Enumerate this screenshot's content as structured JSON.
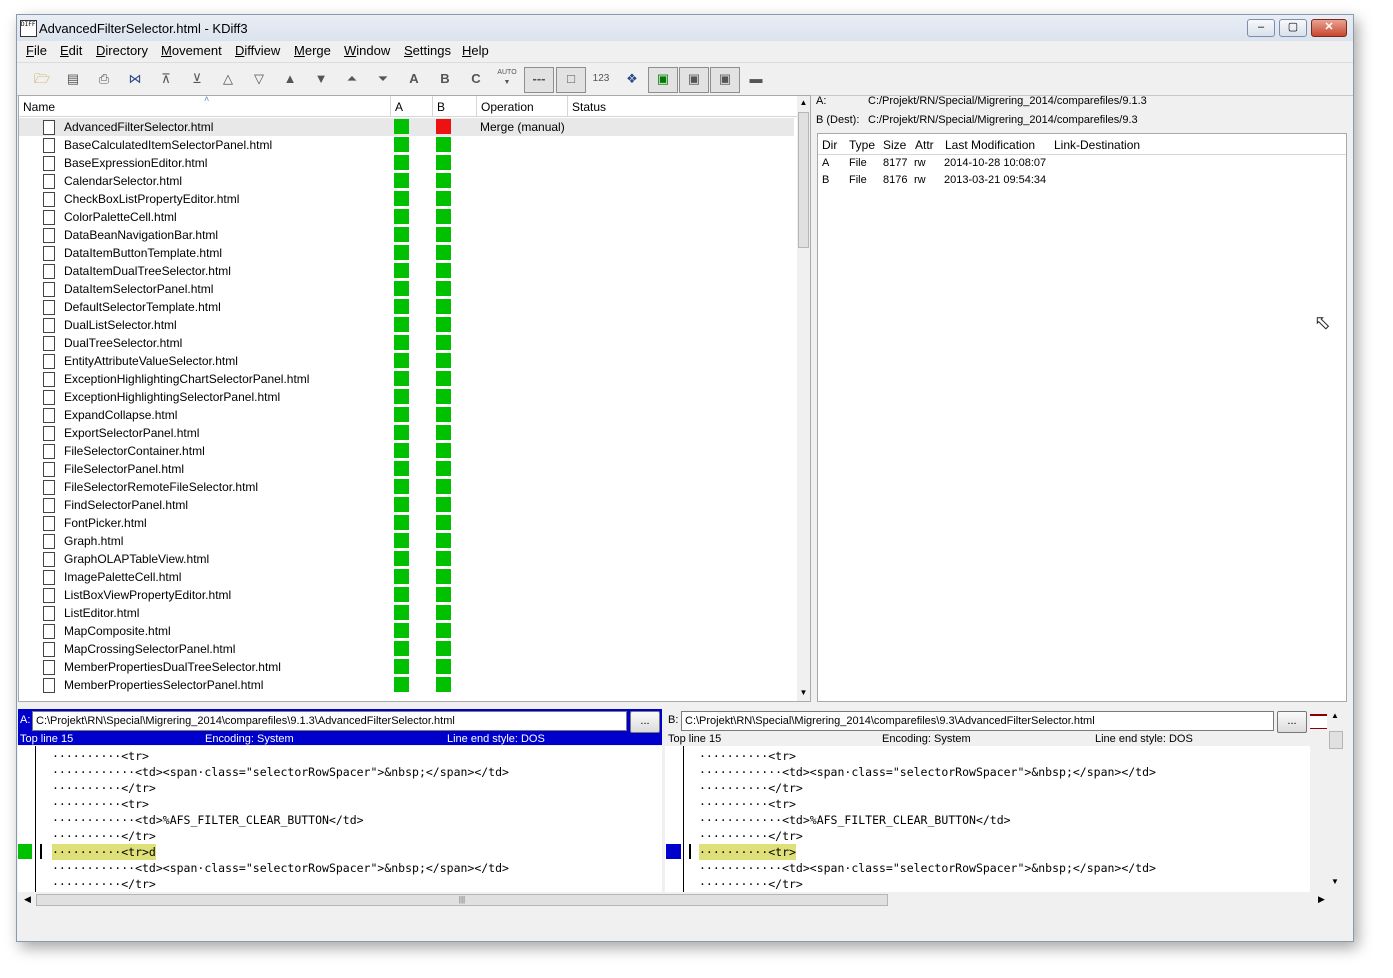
{
  "window": {
    "title": "AdvancedFilterSelector.html - KDiff3",
    "app_icon_text": "DIFF3"
  },
  "menu": [
    "File",
    "Edit",
    "Directory",
    "Movement",
    "Diffview",
    "Merge",
    "Window",
    "Settings",
    "Help"
  ],
  "toolbar": {
    "auto_label": "AUTO",
    "a_label": "A",
    "b_label": "B",
    "c_label": "C",
    "numbers_label": "123"
  },
  "dir_table": {
    "headers": {
      "name": "Name",
      "a": "A",
      "b": "B",
      "operation": "Operation",
      "status": "Status"
    },
    "rows": [
      {
        "name": "AdvancedFilterSelector.html",
        "operation": "Merge (manual)",
        "b_status": "red"
      },
      {
        "name": "BaseCalculatedItemSelectorPanel.html",
        "operation": "",
        "b_status": "green"
      },
      {
        "name": "BaseExpressionEditor.html",
        "operation": "",
        "b_status": "green"
      },
      {
        "name": "CalendarSelector.html",
        "operation": "",
        "b_status": "green"
      },
      {
        "name": "CheckBoxListPropertyEditor.html",
        "operation": "",
        "b_status": "green"
      },
      {
        "name": "ColorPaletteCell.html",
        "operation": "",
        "b_status": "green"
      },
      {
        "name": "DataBeanNavigationBar.html",
        "operation": "",
        "b_status": "green"
      },
      {
        "name": "DataItemButtonTemplate.html",
        "operation": "",
        "b_status": "green"
      },
      {
        "name": "DataItemDualTreeSelector.html",
        "operation": "",
        "b_status": "green"
      },
      {
        "name": "DataItemSelectorPanel.html",
        "operation": "",
        "b_status": "green"
      },
      {
        "name": "DefaultSelectorTemplate.html",
        "operation": "",
        "b_status": "green"
      },
      {
        "name": "DualListSelector.html",
        "operation": "",
        "b_status": "green"
      },
      {
        "name": "DualTreeSelector.html",
        "operation": "",
        "b_status": "green"
      },
      {
        "name": "EntityAttributeValueSelector.html",
        "operation": "",
        "b_status": "green"
      },
      {
        "name": "ExceptionHighlightingChartSelectorPanel.html",
        "operation": "",
        "b_status": "green"
      },
      {
        "name": "ExceptionHighlightingSelectorPanel.html",
        "operation": "",
        "b_status": "green"
      },
      {
        "name": "ExpandCollapse.html",
        "operation": "",
        "b_status": "green"
      },
      {
        "name": "ExportSelectorPanel.html",
        "operation": "",
        "b_status": "green"
      },
      {
        "name": "FileSelectorContainer.html",
        "operation": "",
        "b_status": "green"
      },
      {
        "name": "FileSelectorPanel.html",
        "operation": "",
        "b_status": "green"
      },
      {
        "name": "FileSelectorRemoteFileSelector.html",
        "operation": "",
        "b_status": "green"
      },
      {
        "name": "FindSelectorPanel.html",
        "operation": "",
        "b_status": "green"
      },
      {
        "name": "FontPicker.html",
        "operation": "",
        "b_status": "green"
      },
      {
        "name": "Graph.html",
        "operation": "",
        "b_status": "green"
      },
      {
        "name": "GraphOLAPTableView.html",
        "operation": "",
        "b_status": "green"
      },
      {
        "name": "ImagePaletteCell.html",
        "operation": "",
        "b_status": "green"
      },
      {
        "name": "ListBoxViewPropertyEditor.html",
        "operation": "",
        "b_status": "green"
      },
      {
        "name": "ListEditor.html",
        "operation": "",
        "b_status": "green"
      },
      {
        "name": "MapComposite.html",
        "operation": "",
        "b_status": "green"
      },
      {
        "name": "MapCrossingSelectorPanel.html",
        "operation": "",
        "b_status": "green"
      },
      {
        "name": "MemberPropertiesDualTreeSelector.html",
        "operation": "",
        "b_status": "green"
      },
      {
        "name": "MemberPropertiesSelectorPanel.html",
        "operation": "",
        "b_status": "green"
      }
    ]
  },
  "info_panel": {
    "a_label": "A:",
    "a_path": "C:/Projekt/RN/Special/Migrering_2014/comparefiles/9.1.3",
    "b_label": "B (Dest):",
    "b_path": "C:/Projekt/RN/Special/Migrering_2014/comparefiles/9.3",
    "headers": [
      "Dir",
      "Type",
      "Size",
      "Attr",
      "Last Modification",
      "Link-Destination"
    ],
    "rows": [
      [
        "A",
        "File",
        "8177",
        "rw",
        "2014-10-28 10:08:07",
        ""
      ],
      [
        "B",
        "File",
        "8176",
        "rw",
        "2013-03-21 09:54:34",
        ""
      ]
    ]
  },
  "diff_a": {
    "label": "A:",
    "path": "C:\\Projekt\\RN\\Special\\Migrering_2014\\comparefiles\\9.1.3\\AdvancedFilterSelector.html",
    "browse": "...",
    "top_line": "Top line 15",
    "encoding": "Encoding: System",
    "line_end": "Line end style: DOS",
    "lines": [
      "··········<tr>",
      "············<td><span·class=\"selectorRowSpacer\">&nbsp;</span></td>",
      "··········</tr>",
      "··········<tr>",
      "············<td>%AFS_FILTER_CLEAR_BUTTON</td>",
      "··········</tr>",
      "··········<tr>d",
      "············<td><span·class=\"selectorRowSpacer\">&nbsp;</span></td>",
      "··········</tr>"
    ]
  },
  "diff_b": {
    "label": "B:",
    "path": "C:\\Projekt\\RN\\Special\\Migrering_2014\\comparefiles\\9.3\\AdvancedFilterSelector.html",
    "browse": "...",
    "top_line": "Top line 15",
    "encoding": "Encoding: System",
    "line_end": "Line end style: DOS",
    "lines": [
      "··········<tr>",
      "············<td><span·class=\"selectorRowSpacer\">&nbsp;</span></td>",
      "··········</tr>",
      "··········<tr>",
      "············<td>%AFS_FILTER_CLEAR_BUTTON</td>",
      "··········</tr>",
      "··········<tr>",
      "············<td><span·class=\"selectorRowSpacer\">&nbsp;</span></td>",
      "··········</tr>"
    ]
  },
  "colors": {
    "green": "#00c000",
    "red": "#ee1111",
    "active_header": "#0000cc",
    "blue_marker": "#0000cc",
    "highlight": "#e0e07a"
  }
}
